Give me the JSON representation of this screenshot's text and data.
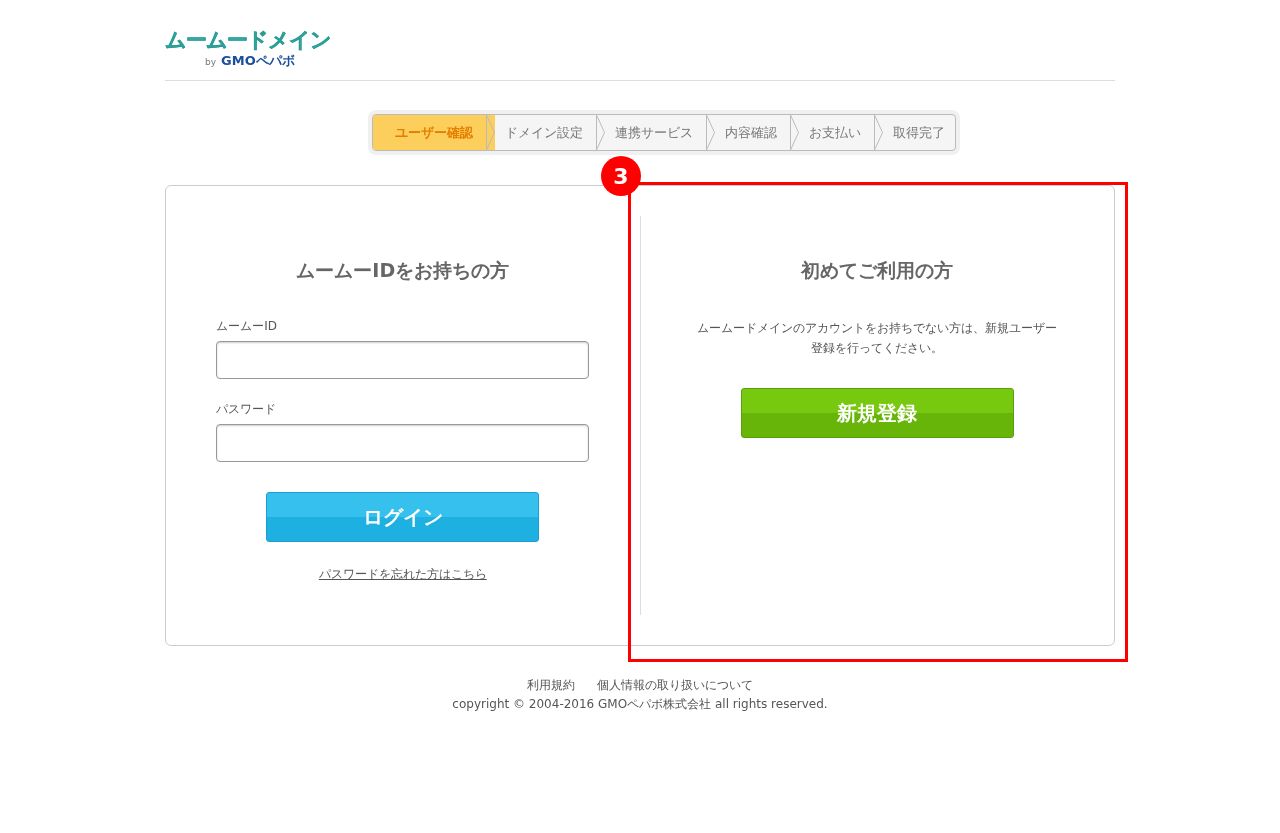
{
  "logo": {
    "name": "ムームードメイン",
    "by": "by",
    "company": "GMOペパボ"
  },
  "steps": [
    {
      "label": "ユーザー確認",
      "selected": true
    },
    {
      "label": "ドメイン設定",
      "selected": false
    },
    {
      "label": "連携サービス",
      "selected": false
    },
    {
      "label": "内容確認",
      "selected": false
    },
    {
      "label": "お支払い",
      "selected": false
    },
    {
      "label": "取得完了",
      "selected": false
    }
  ],
  "login": {
    "title": "ムームーIDをお持ちの方",
    "fields": [
      {
        "label": "ムームーID"
      },
      {
        "label": "パスワード"
      }
    ],
    "button": "ログイン",
    "forgot_link": "パスワードを忘れた方はこちら"
  },
  "signup": {
    "title": "初めてご利用の方",
    "text": "ムームードメインのアカウントをお持ちでない方は、新規ユーザー登録を行ってください。",
    "button": "新規登録"
  },
  "annotation": {
    "number": "3"
  },
  "footer": {
    "links": [
      "利用規約",
      "個人情報の取り扱いについて"
    ],
    "copyright": "copyright © 2004-2016 GMOペパボ株式会社 all rights reserved."
  }
}
